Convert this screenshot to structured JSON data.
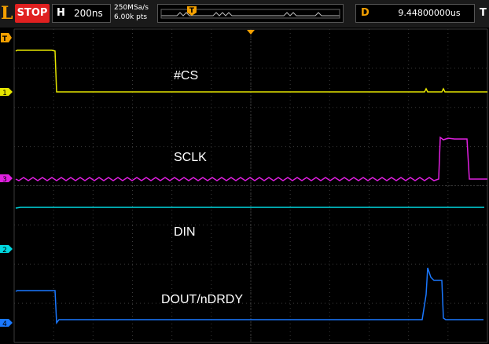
{
  "toolbar": {
    "logo_letter": "L",
    "run_state": "STOP",
    "horizontal": {
      "key": "H",
      "timebase": "200ns"
    },
    "acquisition": {
      "sample_rate": "250MSa/s",
      "points": "6.00k pts"
    },
    "delay": {
      "key": "D",
      "value": "9.44800000us"
    },
    "trigger_key": "T",
    "trigger_marker_glyph": "T"
  },
  "colors": {
    "ch1": "#e6e600",
    "ch2": "#00d8e0",
    "ch3": "#e020e0",
    "ch4": "#1a78ff",
    "trigger": "#f4a000",
    "grid": "#3a3a3a",
    "stop": "#e02020"
  },
  "channels": [
    {
      "id": "1",
      "color": "#e6e600",
      "label": "#CS"
    },
    {
      "id": "3",
      "color": "#e020e0",
      "label": "SCLK"
    },
    {
      "id": "2",
      "color": "#00d8e0",
      "label": "DIN"
    },
    {
      "id": "4",
      "color": "#1a78ff",
      "label": "DOUT/nDRDY"
    }
  ]
}
